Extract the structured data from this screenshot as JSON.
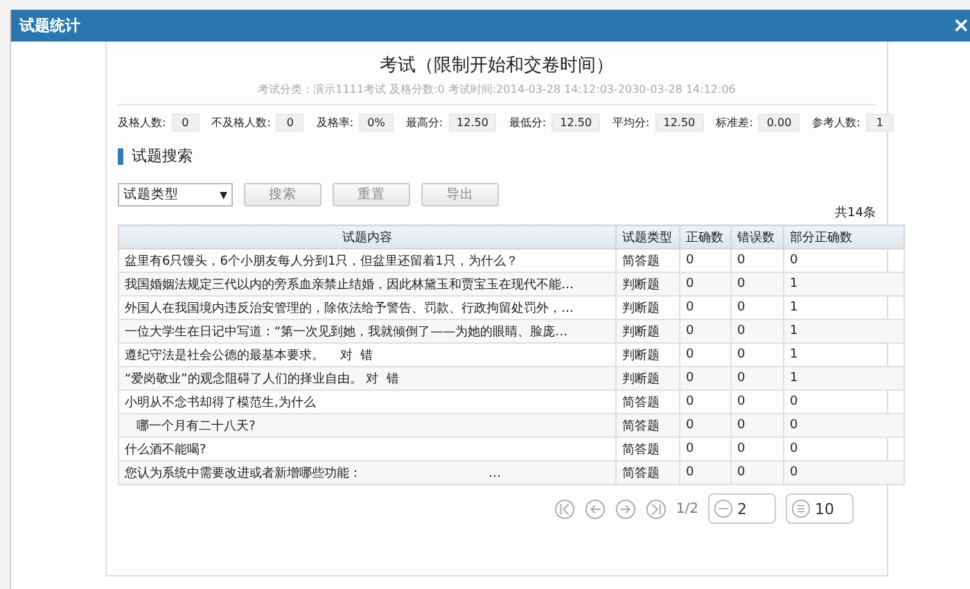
{
  "window": {
    "title": "试题统计",
    "close": "×"
  },
  "exam": {
    "title": "考试（限制开始和交卷时间）",
    "subtitle": "考试分类：演示1111考试  及格分数:0  考试时间:2014-03-28 14:12:03-2030-03-28 14:12:06"
  },
  "stats": [
    {
      "label": "及格人数:",
      "value": "0"
    },
    {
      "label": "不及格人数:",
      "value": "0"
    },
    {
      "label": "及格率:",
      "value": "0%"
    },
    {
      "label": "最高分:",
      "value": "12.50"
    },
    {
      "label": "最低分:",
      "value": "12.50"
    },
    {
      "label": "平均分:",
      "value": "12.50"
    },
    {
      "label": "标准差:",
      "value": "0.00"
    },
    {
      "label": "参考人数:",
      "value": "1"
    }
  ],
  "section_title": "试题搜索",
  "toolbar": {
    "type_select": "试题类型",
    "caret": "▼",
    "buttons": [
      "搜索",
      "重置",
      "导出"
    ],
    "total": "共14条"
  },
  "table": {
    "columns": [
      "试题内容",
      "试题类型",
      "正确数",
      "错误数",
      "部分正确数"
    ],
    "rows": [
      [
        "盆里有6只馒头，6个小朋友每人分到1只，但盆里还留着1只，为什么？",
        "简答题",
        "0",
        "0",
        "0"
      ],
      [
        "我国婚姻法规定三代以内的旁系血亲禁止结婚，因此林黛玉和贾宝玉在现代不能…",
        "判断题",
        "0",
        "0",
        "1"
      ],
      [
        "外国人在我国境内违反治安管理的，除依法给予警告、罚款、行政拘留处罚外，…",
        "判断题",
        "0",
        "0",
        "1"
      ],
      [
        "一位大学生在日记中写道：“第一次见到她，我就倾倒了——为她的眼睛、脸庞…",
        "判断题",
        "0",
        "0",
        "1"
      ],
      [
        "遵纪守法是社会公德的最基本要求。    对  错",
        "判断题",
        "0",
        "0",
        "1"
      ],
      [
        "“爱岗敬业”的观念阻碍了人们的择业自由。 对  错",
        "判断题",
        "0",
        "0",
        "1"
      ],
      [
        "小明从不念书却得了模范生,为什么",
        "简答题",
        "0",
        "0",
        "0"
      ],
      [
        "   哪一个月有二十八天?",
        "简答题",
        "0",
        "0",
        "0"
      ],
      [
        "什么酒不能喝?",
        "简答题",
        "0",
        "0",
        "0"
      ],
      [
        "您认为系统中需要改进或者新增哪些功能：                                …",
        "简答题",
        "0",
        "0",
        "0"
      ]
    ]
  },
  "pager": {
    "page": "1/2",
    "goto": "2",
    "page_size": "10"
  }
}
